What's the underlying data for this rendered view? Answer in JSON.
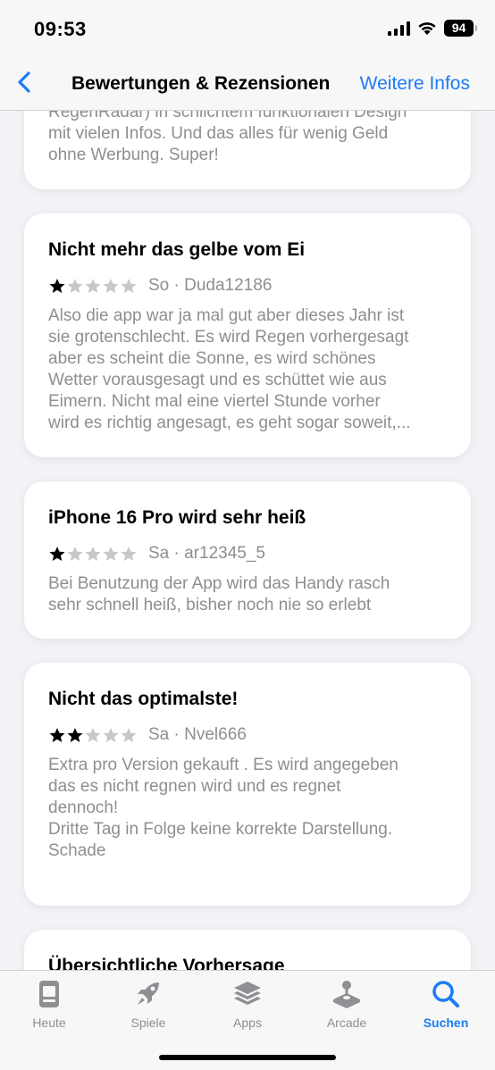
{
  "status": {
    "time": "09:53",
    "battery": "94"
  },
  "nav": {
    "title": "Bewertungen & Rezensionen",
    "more": "Weitere Infos"
  },
  "colors": {
    "accent": "#1b7cf6",
    "star": "#000000",
    "star_empty": "#c7c7cc",
    "secondary_text": "#8e8e93"
  },
  "reviews": [
    {
      "title": "",
      "rating": 0,
      "meta": "",
      "body": "RegenRadar) in schlichtem funktionalen Design\nmit vielen Infos. Und das alles für wenig Geld\nohne Werbung. Super!"
    },
    {
      "title": "Nicht mehr das gelbe vom Ei",
      "rating": 1,
      "meta": "So · Duda12186",
      "body": "Also die app war ja mal gut aber dieses Jahr ist\nsie grotenschlecht. Es wird Regen vorhergesagt\naber es scheint die Sonne, es wird schönes\nWetter vorausgesagt und es schüttet wie aus\nEimern. Nicht mal eine viertel Stunde vorher\nwird es richtig angesagt, es geht sogar soweit,..."
    },
    {
      "title": "iPhone 16 Pro wird sehr heiß",
      "rating": 1,
      "meta": "Sa · ar12345_5",
      "body": "Bei Benutzung der App wird das Handy rasch\nsehr schnell heiß, bisher noch nie so erlebt"
    },
    {
      "title": "Nicht das optimalste!",
      "rating": 2,
      "meta": "Sa · Nvel666",
      "body": "Extra pro Version gekauft . Es wird angegeben\ndas es nicht regnen wird und es regnet\ndennoch!\nDritte Tag in Folge keine korrekte Darstellung.\nSchade"
    },
    {
      "title": "Übersichtliche Vorhersage",
      "rating": 0,
      "meta": "",
      "body": ""
    }
  ],
  "tabs": [
    {
      "label": "Heute",
      "icon": "today-icon",
      "active": false
    },
    {
      "label": "Spiele",
      "icon": "rocket-icon",
      "active": false
    },
    {
      "label": "Apps",
      "icon": "apps-stack-icon",
      "active": false
    },
    {
      "label": "Arcade",
      "icon": "joystick-icon",
      "active": false
    },
    {
      "label": "Suchen",
      "icon": "search-icon",
      "active": true
    }
  ]
}
